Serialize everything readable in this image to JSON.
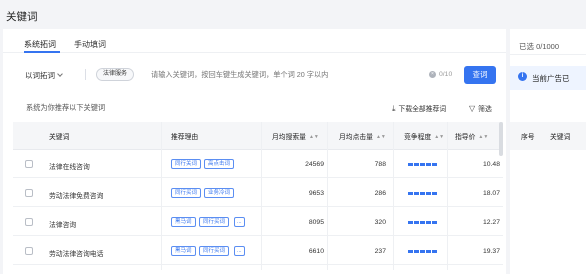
{
  "page": {
    "title": "关键词"
  },
  "tabs": [
    {
      "label": "系统拓词",
      "active": true
    },
    {
      "label": "手动填词",
      "active": false
    }
  ],
  "input": {
    "mode": "以词拓词",
    "chip": "法律服务",
    "placeholder": "请输入关键词，按回车键生成关键词，单个词 20 字以内",
    "counter": "0/10",
    "query_button": "查词"
  },
  "recommend": {
    "label": "系统为你推荐以下关键词",
    "download": "下载全部推荐词",
    "filter": "筛选"
  },
  "table": {
    "headers": {
      "keyword": "关键词",
      "reason": "推荐理由",
      "monthly_search": "月均搜索量",
      "monthly_click": "月均点击量",
      "competition": "竞争程度",
      "guide_price": "指导价"
    },
    "rows": [
      {
        "keyword": "法律在线咨询",
        "tags": [
          "同行关词",
          "高点击词"
        ],
        "more": false,
        "search": "24569",
        "click": "788",
        "competition": 5,
        "price": "10.48"
      },
      {
        "keyword": "劳动法律免费咨询",
        "tags": [
          "同行买词",
          "业务冷词"
        ],
        "more": false,
        "search": "9653",
        "click": "286",
        "competition": 5,
        "price": "18.07"
      },
      {
        "keyword": "法律咨询",
        "tags": [
          "黑马词",
          "同行买词"
        ],
        "more": true,
        "search": "8095",
        "click": "320",
        "competition": 5,
        "price": "12.27"
      },
      {
        "keyword": "劳动法律咨询电话",
        "tags": [
          "黑马词",
          "同行买词"
        ],
        "more": true,
        "search": "6610",
        "click": "237",
        "competition": 5,
        "price": "19.37"
      }
    ],
    "more_label": "..."
  },
  "right_panel": {
    "selected": "已选 0/1000",
    "notice": "当前广告已",
    "headers": {
      "index": "序号",
      "keyword": "关键词"
    }
  },
  "colors": {
    "accent": "#3574f0",
    "background": "#f3f4f7"
  },
  "icons": [
    "clear-icon",
    "download-icon",
    "filter-icon",
    "info-icon",
    "sort-icon",
    "chevron-down-icon"
  ]
}
